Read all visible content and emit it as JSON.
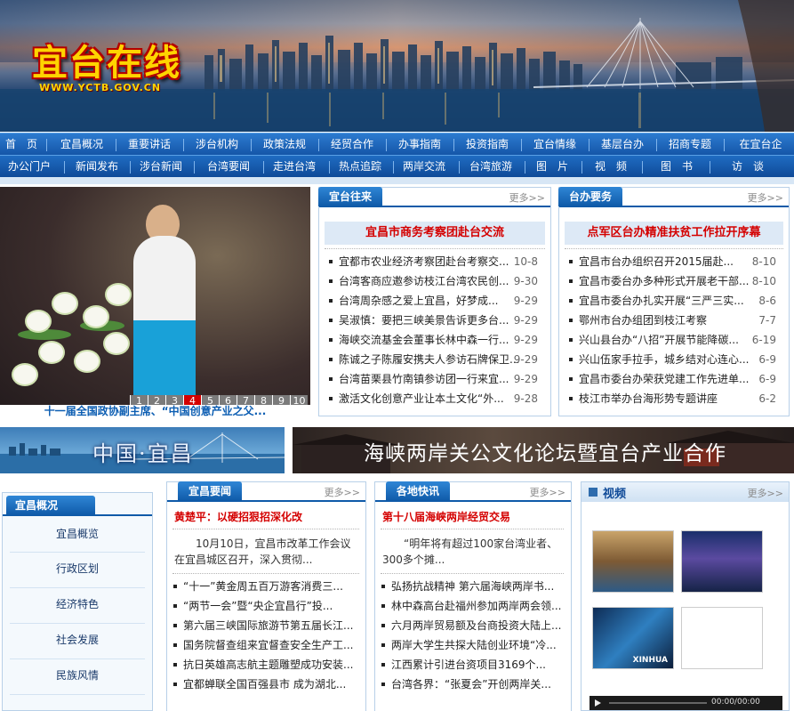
{
  "site": {
    "logo": "宜台在线",
    "domain": "WWW.YCTB.GOV.CN"
  },
  "nav_primary": [
    "首　页",
    "宜昌概况",
    "重要讲话",
    "涉台机构",
    "政策法规",
    "经贸合作",
    "办事指南",
    "投资指南",
    "宜台情缘",
    "基层台办",
    "招商专题",
    "在宜台企"
  ],
  "nav_secondary": [
    "办公门户",
    "新闻发布",
    "涉台新闻",
    "台湾要闻",
    "走进台湾",
    "热点追踪",
    "两岸交流",
    "台湾旅游",
    "图　片",
    "视　频",
    "图　书",
    "访　谈"
  ],
  "slideshow": {
    "pages": [
      "1",
      "2",
      "3",
      "4",
      "5",
      "6",
      "7",
      "8",
      "9",
      "10"
    ],
    "active_page": "4",
    "caption": "十一届全国政协副主席、“中国创意产业之父..."
  },
  "yitai": {
    "tab": "宜台往来",
    "more": "更多>>",
    "headline": "宜昌市商务考察团赴台交流",
    "items": [
      {
        "title": "宜都市农业经济考察团赴台考察交...",
        "date": "10-8"
      },
      {
        "title": "台湾客商应邀参访枝江台湾农民创...",
        "date": "9-30"
      },
      {
        "title": "台湾周杂感之爱上宜昌，好梦成...",
        "date": "9-29"
      },
      {
        "title": "吴淑慎：要把三峡美景告诉更多台...",
        "date": "9-29"
      },
      {
        "title": "海峡交流基金会董事长林中森一行...",
        "date": "9-29"
      },
      {
        "title": "陈诚之子陈履安携夫人参访石牌保卫...",
        "date": "9-29"
      },
      {
        "title": "台湾苗栗县竹南镇参访团一行来宜...",
        "date": "9-29"
      },
      {
        "title": "激活文化创意产业让本土文化“外...",
        "date": "9-28"
      }
    ]
  },
  "taiban": {
    "tab": "台办要务",
    "more": "更多>>",
    "headline": "点军区台办精准扶贫工作拉开序幕",
    "items": [
      {
        "title": "宜昌市台办组织召开2015届赴...",
        "date": "8-10"
      },
      {
        "title": "宜昌市委台办多种形式开展老干部...",
        "date": "8-10"
      },
      {
        "title": "宜昌市委台办扎实开展“三严三实...",
        "date": "8-6"
      },
      {
        "title": "鄂州市台办组团到枝江考察",
        "date": "7-7"
      },
      {
        "title": "兴山县台办“八招”开展节能降碳...",
        "date": "6-19"
      },
      {
        "title": "兴山伍家手拉手，城乡结对心连心...",
        "date": "6-9"
      },
      {
        "title": "宜昌市委台办荣获党建工作先进单...",
        "date": "6-9"
      },
      {
        "title": "枝江市举办台海形势专题讲座",
        "date": "6-2"
      }
    ]
  },
  "banners": {
    "left": "中国·宜昌",
    "right": "海峡两岸关公文化论坛暨宜台产业合作"
  },
  "sidebar": {
    "title": "宜昌概况",
    "items": [
      "宜昌概览",
      "行政区划",
      "经济特色",
      "社会发展",
      "民族风情"
    ]
  },
  "yichang_news": {
    "tab": "宜昌要闻",
    "more": "更多>>",
    "headline": "黄楚平：以硬招狠招深化改",
    "summary": "10月10日，宜昌市改革工作会议在宜昌城区召开，深入贯彻...",
    "items": [
      "“十一”黄金周五百万游客消费三...",
      "“两节一会”暨“央企宜昌行”投...",
      "第六届三峡国际旅游节第五届长江...",
      "国务院督查组来宜督查安全生产工...",
      "抗日英雄高志航主题雕塑成功安装...",
      "宜都蝉联全国百强县市 成为湖北..."
    ]
  },
  "local_news": {
    "tab": "各地快讯",
    "more": "更多>>",
    "headline": "第十八届海峡两岸经贸交易",
    "summary": "“明年将有超过100家台湾业者、300多个摊...",
    "items": [
      "弘扬抗战精神 第六届海峡两岸书...",
      "林中森高台赴福州参加两岸两会领...",
      "六月两岸贸易额及台商投资大陆上...",
      "两岸大学生共探大陆创业环境“冷...",
      "江西累计引进台资项目3169个...",
      "台湾各界：“张夏会”开创两岸关..."
    ]
  },
  "video": {
    "title": "视频",
    "more": "更多>>",
    "thumb_label": "XINHUA",
    "time": "00:00/00:00"
  },
  "colors": {
    "nav": "#1a66bc",
    "accent_red": "#d40000",
    "tab_blue": "#0f5aa8"
  }
}
